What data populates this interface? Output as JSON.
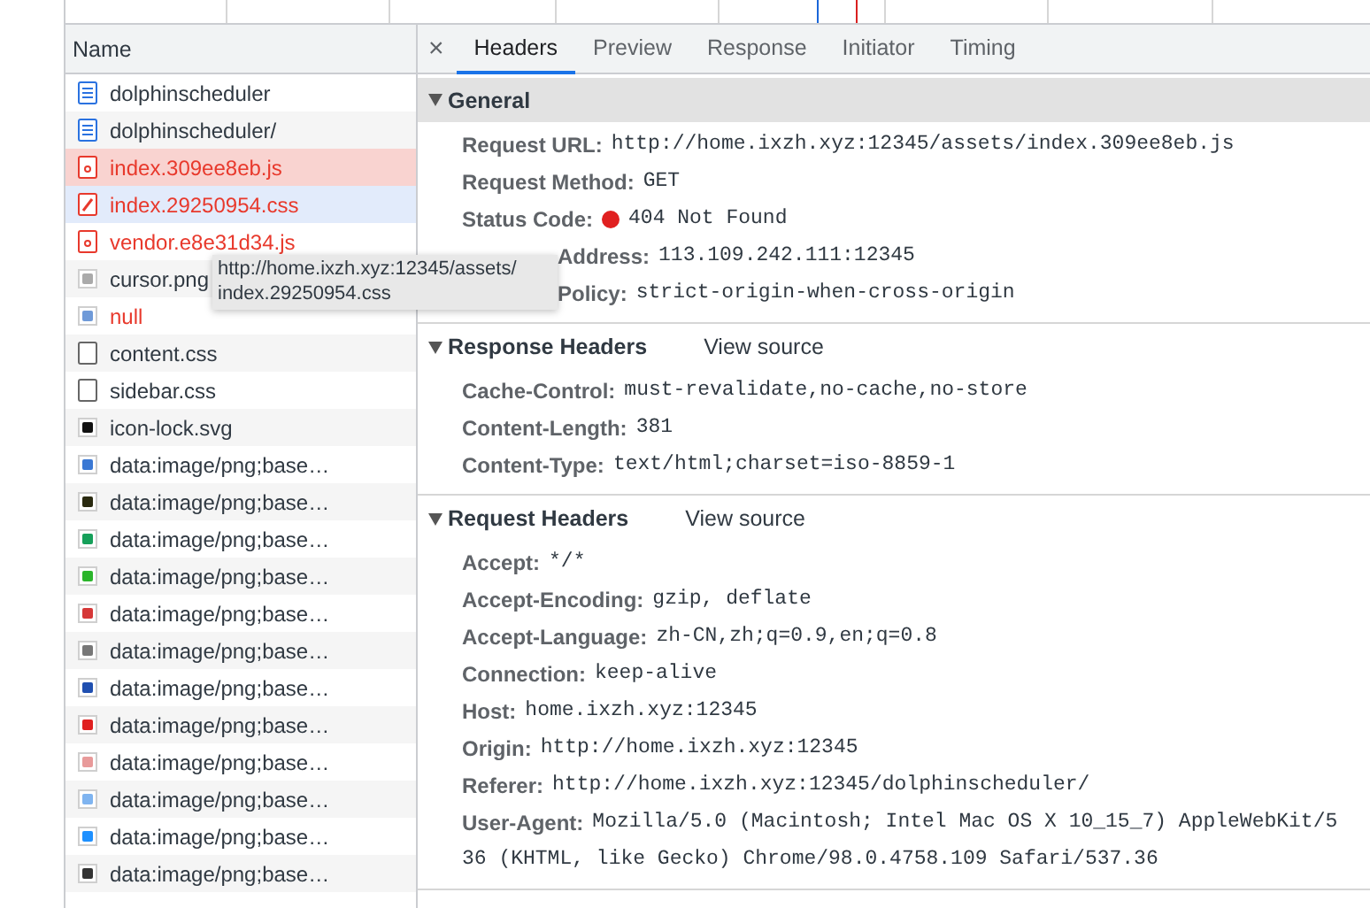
{
  "name_column": {
    "heading": "Name"
  },
  "files": [
    {
      "name": "dolphinscheduler",
      "kind": "document",
      "selected": false,
      "hovered": false,
      "error": false
    },
    {
      "name": "dolphinscheduler/",
      "kind": "document",
      "selected": false,
      "hovered": false,
      "error": false
    },
    {
      "name": "index.309ee8eb.js",
      "kind": "script",
      "selected": true,
      "hovered": false,
      "error": true
    },
    {
      "name": "index.29250954.css",
      "kind": "stylesheet",
      "selected": false,
      "hovered": true,
      "error": true
    },
    {
      "name": "vendor.e8e31d34.js",
      "kind": "script",
      "selected": false,
      "hovered": false,
      "error": true
    },
    {
      "name": "cursor.png",
      "kind": "image",
      "color": "#aaaaaa",
      "selected": false,
      "hovered": false,
      "error": false
    },
    {
      "name": "null",
      "kind": "image",
      "color": "#6f9ad8",
      "selected": false,
      "hovered": false,
      "error": true
    },
    {
      "name": "content.css",
      "kind": "blank",
      "selected": false,
      "hovered": false,
      "error": false
    },
    {
      "name": "sidebar.css",
      "kind": "blank",
      "selected": false,
      "hovered": false,
      "error": false
    },
    {
      "name": "icon-lock.svg",
      "kind": "image",
      "color": "#111111",
      "selected": false,
      "hovered": false,
      "error": false
    },
    {
      "name": "data:image/png;base…",
      "kind": "image",
      "color": "#3a78d4",
      "selected": false,
      "hovered": false,
      "error": false
    },
    {
      "name": "data:image/png;base…",
      "kind": "image",
      "color": "#2a2a10",
      "selected": false,
      "hovered": false,
      "error": false
    },
    {
      "name": "data:image/png;base…",
      "kind": "image",
      "color": "#16a05a",
      "selected": false,
      "hovered": false,
      "error": false
    },
    {
      "name": "data:image/png;base…",
      "kind": "image",
      "color": "#2bb52b",
      "selected": false,
      "hovered": false,
      "error": false
    },
    {
      "name": "data:image/png;base…",
      "kind": "image",
      "color": "#d63838",
      "selected": false,
      "hovered": false,
      "error": false
    },
    {
      "name": "data:image/png;base…",
      "kind": "image",
      "color": "#777777",
      "selected": false,
      "hovered": false,
      "error": false
    },
    {
      "name": "data:image/png;base…",
      "kind": "image",
      "color": "#1f4fb0",
      "selected": false,
      "hovered": false,
      "error": false
    },
    {
      "name": "data:image/png;base…",
      "kind": "image",
      "color": "#e02020",
      "selected": false,
      "hovered": false,
      "error": false
    },
    {
      "name": "data:image/png;base…",
      "kind": "image",
      "color": "#e89a9a",
      "selected": false,
      "hovered": false,
      "error": false
    },
    {
      "name": "data:image/png;base…",
      "kind": "image",
      "color": "#7fb4f0",
      "selected": false,
      "hovered": false,
      "error": false
    },
    {
      "name": "data:image/png;base…",
      "kind": "image",
      "color": "#1e90ff",
      "selected": false,
      "hovered": false,
      "error": false
    },
    {
      "name": "data:image/png;base…",
      "kind": "image",
      "color": "#333333",
      "selected": false,
      "hovered": false,
      "error": false
    }
  ],
  "tooltip": {
    "lines": [
      "http://home.ixzh.xyz:12345/assets/",
      "index.29250954.css"
    ]
  },
  "details": {
    "close": "×",
    "tabs": [
      {
        "label": "Headers",
        "selected": true
      },
      {
        "label": "Preview",
        "selected": false
      },
      {
        "label": "Response",
        "selected": false
      },
      {
        "label": "Initiator",
        "selected": false
      },
      {
        "label": "Timing",
        "selected": false
      }
    ],
    "sections": [
      {
        "title": "General",
        "expanded": true,
        "highlighted": true,
        "rows": [
          {
            "kind": "plain",
            "label": "Request URL:",
            "value": "http://home.ixzh.xyz:12345/assets/index.309ee8eb.js"
          },
          {
            "kind": "plain",
            "label": "Request Method:",
            "value": "GET"
          },
          {
            "kind": "status",
            "label": "Status Code:",
            "value": "404 Not Found"
          },
          {
            "kind": "partial",
            "label": "Address:",
            "value": "113.109.242.111:12345"
          },
          {
            "kind": "partial",
            "label": "Policy:",
            "value": "strict-origin-when-cross-origin"
          }
        ]
      },
      {
        "title": "Response Headers",
        "link": "View source",
        "expanded": true,
        "highlighted": false,
        "rows": [
          {
            "kind": "plain",
            "label": "Cache-Control:",
            "value": "must-revalidate,no-cache,no-store"
          },
          {
            "kind": "plain",
            "label": "Content-Length:",
            "value": "381"
          },
          {
            "kind": "plain",
            "label": "Content-Type:",
            "value": "text/html;charset=iso-8859-1"
          }
        ]
      },
      {
        "title": "Request Headers",
        "link": "View source",
        "expanded": true,
        "highlighted": false,
        "rows": [
          {
            "kind": "plain",
            "label": "Accept:",
            "value": "*/*"
          },
          {
            "kind": "plain",
            "label": "Accept-Encoding:",
            "value": "gzip, deflate"
          },
          {
            "kind": "plain",
            "label": "Accept-Language:",
            "value": "zh-CN,zh;q=0.9,en;q=0.8"
          },
          {
            "kind": "plain",
            "label": "Connection:",
            "value": "keep-alive"
          },
          {
            "kind": "plain",
            "label": "Host:",
            "value": "home.ixzh.xyz:12345"
          },
          {
            "kind": "plain",
            "label": "Origin:",
            "value": "http://home.ixzh.xyz:12345"
          },
          {
            "kind": "plain",
            "label": "Referer:",
            "value": "http://home.ixzh.xyz:12345/dolphinscheduler/"
          },
          {
            "kind": "plain",
            "label": "User-Agent:",
            "value": "Mozilla/5.0 (Macintosh; Intel Mac OS X 10_15_7) AppleWebKit/5",
            "continuation": "36 (KHTML, like Gecko) Chrome/98.0.4758.109 Safari/537.36"
          }
        ]
      }
    ]
  }
}
